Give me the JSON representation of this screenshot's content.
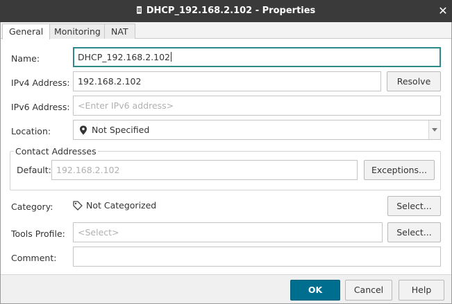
{
  "window": {
    "title": "DHCP_192.168.2.102 - Properties"
  },
  "tabs": [
    {
      "label": "General"
    },
    {
      "label": "Monitoring"
    },
    {
      "label": "NAT"
    }
  ],
  "form": {
    "name_label": "Name:",
    "name_value": "DHCP_192.168.2.102",
    "ipv4_label": "IPv4 Address:",
    "ipv4_value": "192.168.2.102",
    "resolve_label": "Resolve",
    "ipv6_label": "IPv6 Address:",
    "ipv6_placeholder": "<Enter IPv6 address>",
    "location_label": "Location:",
    "location_value": "Not Specified",
    "contact_title": "Contact Addresses",
    "default_label": "Default:",
    "default_value": "192.168.2.102",
    "exceptions_label": "Exceptions...",
    "category_label": "Category:",
    "category_value": "Not Categorized",
    "category_select_label": "Select...",
    "tools_label": "Tools Profile:",
    "tools_placeholder": "<Select>",
    "tools_select_label": "Select...",
    "comment_label": "Comment:",
    "comment_value": ""
  },
  "footer": {
    "ok_label": "OK",
    "cancel_label": "Cancel",
    "help_label": "Help"
  }
}
